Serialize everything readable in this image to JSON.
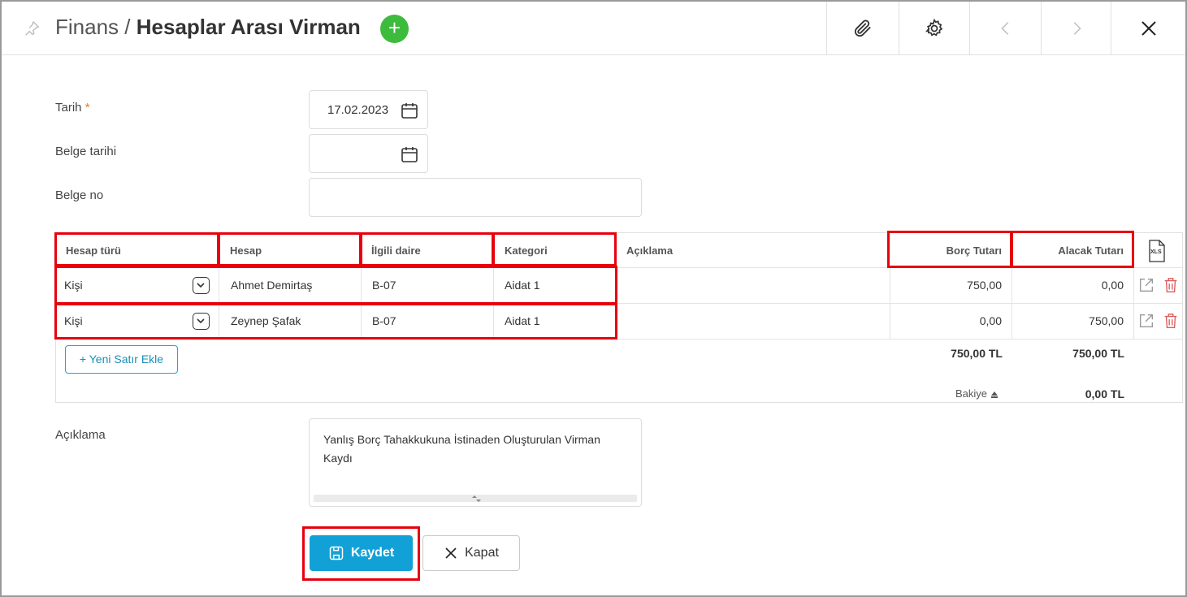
{
  "header": {
    "section": "Finans",
    "separator": "/",
    "title": "Hesaplar Arası Virman",
    "add_symbol": "+"
  },
  "form": {
    "tarih_label": "Tarih",
    "required_mark": "*",
    "tarih_value": "17.02.2023",
    "belge_tarihi_label": "Belge tarihi",
    "belge_tarihi_value": "",
    "belge_no_label": "Belge no",
    "belge_no_value": ""
  },
  "grid": {
    "columns": {
      "hesap_turu": "Hesap türü",
      "hesap": "Hesap",
      "ilgili_daire": "İlgili daire",
      "kategori": "Kategori",
      "aciklama": "Açıklama",
      "borc": "Borç Tutarı",
      "alacak": "Alacak Tutarı"
    },
    "export_label": "XLS",
    "rows": [
      {
        "hesap_turu": "Kişi",
        "hesap": "Ahmet Demirtaş",
        "daire": "B-07",
        "kategori": "Aidat 1",
        "aciklama": "",
        "borc": "750,00",
        "alacak": "0,00"
      },
      {
        "hesap_turu": "Kişi",
        "hesap": "Zeynep Şafak",
        "daire": "B-07",
        "kategori": "Aidat 1",
        "aciklama": "",
        "borc": "0,00",
        "alacak": "750,00"
      }
    ],
    "add_row_label": "Yeni Satır Ekle",
    "add_row_symbol": "+",
    "total_borc": "750,00 TL",
    "total_alacak": "750,00 TL",
    "bakiye_label": "Bakiye",
    "bakiye_value": "0,00 TL"
  },
  "aciklama": {
    "label": "Açıklama",
    "value": "Yanlış Borç Tahakkukuna İstinaden Oluşturulan Virman Kaydı"
  },
  "actions": {
    "save_label": "Kaydet",
    "close_label": "Kapat"
  },
  "colors": {
    "accent": "#12a1d6",
    "add_green": "#3dbb3d",
    "highlight_red": "#e8000d",
    "delete_red": "#e05a5a"
  }
}
